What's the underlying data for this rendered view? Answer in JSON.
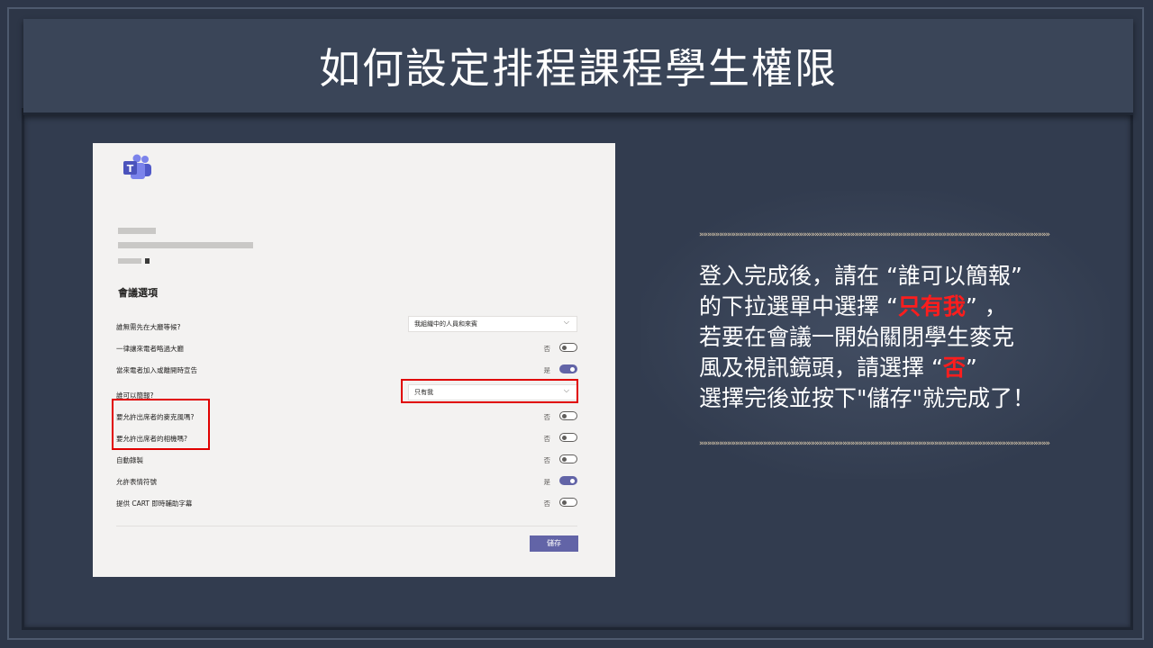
{
  "slide": {
    "title": "如何設定排程課程學生權限"
  },
  "screenshot": {
    "heading": "會議選項",
    "options": [
      {
        "label": "誰無需先在大廳等候?",
        "type": "dropdown",
        "value": "我組織中的人員和來賓"
      },
      {
        "label": "一律讓來電者略過大廳",
        "type": "toggle",
        "state": "否",
        "on": false
      },
      {
        "label": "當來電者加入或離開時宣告",
        "type": "toggle",
        "state": "是",
        "on": true
      },
      {
        "label": "誰可以簡報?",
        "type": "dropdown",
        "value": "只有我"
      },
      {
        "label": "要允許出席者的麥克風嗎?",
        "type": "toggle",
        "state": "否",
        "on": false
      },
      {
        "label": "要允許出席者的相機嗎?",
        "type": "toggle",
        "state": "否",
        "on": false
      },
      {
        "label": "自動錄製",
        "type": "toggle",
        "state": "否",
        "on": false
      },
      {
        "label": "允許表情符號",
        "type": "toggle",
        "state": "是",
        "on": true
      },
      {
        "label": "提供 CART 即時輔助字幕",
        "type": "toggle",
        "state": "否",
        "on": false
      }
    ],
    "save_label": "儲存",
    "icons": {
      "logo": "teams-logo-icon",
      "chevron": "chevron-down-icon"
    },
    "colors": {
      "accent": "#6264a7",
      "highlight": "#e00000"
    }
  },
  "instructions": {
    "arrows": "»»»»»»»»»»»»»»»»»»»»»»»»»»»»»»»»»»»»»»»»»»»»»»»»»»»»»»»»»»»»»»»»»»»»»»»»»»»»»»»»»»»»»»»»",
    "line1": "登入完成後，請在 “誰可以簡報”",
    "line2_pre": "的下拉選單中選擇 “",
    "line2_red": "只有我",
    "line2_post": "” ，",
    "line3": "若要在會議一開始關閉學生麥克",
    "line4_pre": "風及視訊鏡頭，請選擇 “",
    "line4_red": "否",
    "line4_post": "”",
    "line5": "選擇完後並按下\"儲存\"就完成了！",
    "colors": {
      "text": "#ffffff",
      "emphasis": "#ff1d1d",
      "arrows": "#e8d5b5"
    }
  }
}
